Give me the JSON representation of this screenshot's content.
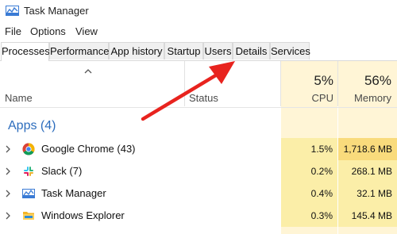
{
  "window": {
    "title": "Task Manager"
  },
  "menu": [
    "File",
    "Options",
    "View"
  ],
  "tabs": [
    "Processes",
    "Performance",
    "App history",
    "Startup",
    "Users",
    "Details",
    "Services"
  ],
  "active_tab": "Processes",
  "columns": {
    "name": "Name",
    "status": "Status",
    "cpu": {
      "percent": "5%",
      "label": "CPU"
    },
    "memory": {
      "percent": "56%",
      "label": "Memory"
    }
  },
  "group": {
    "title": "Apps (4)"
  },
  "processes": [
    {
      "name": "Google Chrome (43)",
      "icon": "chrome-icon",
      "cpu": "1.5%",
      "memory": "1,718.6 MB"
    },
    {
      "name": "Slack (7)",
      "icon": "slack-icon",
      "cpu": "0.2%",
      "memory": "268.1 MB"
    },
    {
      "name": "Task Manager",
      "icon": "task-manager-icon",
      "cpu": "0.4%",
      "memory": "32.1 MB"
    },
    {
      "name": "Windows Explorer",
      "icon": "folder-icon",
      "cpu": "0.3%",
      "memory": "145.4 MB"
    }
  ],
  "colors": {
    "accent_blue": "#2d6dbd",
    "heat_light": "#fbeea8",
    "heat_dark": "#f9db7c",
    "arrow_red": "#e8231e"
  }
}
